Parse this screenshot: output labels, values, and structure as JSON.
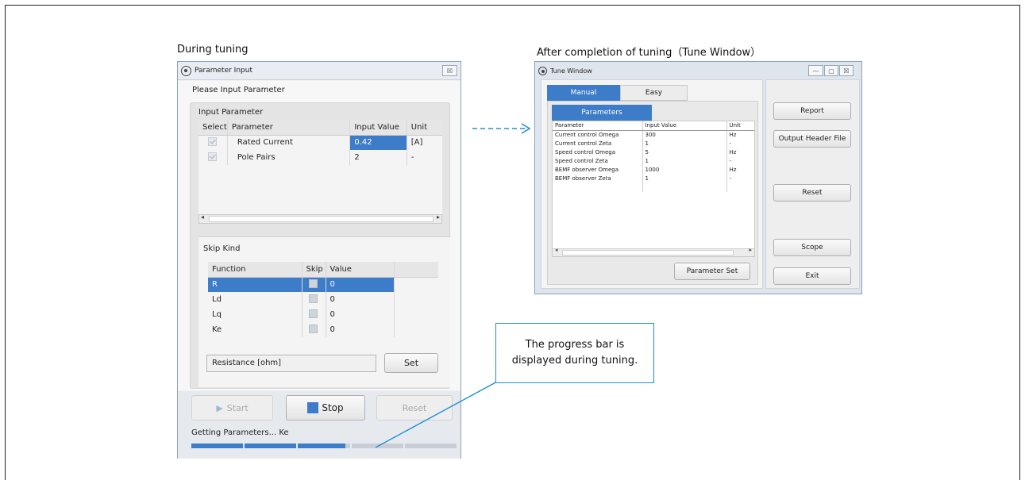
{
  "captions": {
    "during": "During tuning",
    "after": "After completion of tuning（Tune Window）"
  },
  "param_window": {
    "title": "Parameter Input",
    "close_glyph": "☒",
    "prompt": "Please Input Parameter",
    "input_group_label": "Input Parameter",
    "input_table": {
      "headers": [
        "Select",
        "Parameter",
        "Input Value",
        "Unit"
      ],
      "rows": [
        {
          "parameter": "Rated Current",
          "value": "0.42",
          "unit": "[A]"
        },
        {
          "parameter": "Pole Pairs",
          "value": "2",
          "unit": "-"
        }
      ]
    },
    "scroll_left": "◂",
    "scroll_right": "▸",
    "skip_group_label": "Skip Kind",
    "skip_table": {
      "headers": [
        "Function",
        "Skip",
        "Value"
      ],
      "rows": [
        {
          "function": "R",
          "value": "0"
        },
        {
          "function": "Ld",
          "value": "0"
        },
        {
          "function": "Lq",
          "value": "0"
        },
        {
          "function": "Ke",
          "value": "0"
        }
      ]
    },
    "resistance_field": "Resistance [ohm]",
    "set_label": "Set",
    "start_label": "Start",
    "stop_label": "Stop",
    "reset_label": "Reset",
    "status": "Getting Parameters... Ke",
    "progress": 0.58,
    "colors": {
      "accent": "#3d7cc9",
      "progress_done": "#3d7cc9",
      "progress_todo": "#c9ced6"
    }
  },
  "tune_window": {
    "title": "Tune Window",
    "tabs": [
      "Manual",
      "Easy"
    ],
    "sub_tab": "Parameters",
    "table": {
      "headers": [
        "Parameter",
        "Input Value",
        "Unit"
      ],
      "rows": [
        {
          "parameter": "Current control Omega",
          "value": "300",
          "unit": "Hz"
        },
        {
          "parameter": "Current control Zeta",
          "value": "1",
          "unit": "-"
        },
        {
          "parameter": "Speed control Omega",
          "value": "5",
          "unit": "Hz"
        },
        {
          "parameter": "Speed control Zeta",
          "value": "1",
          "unit": "-"
        },
        {
          "parameter": "BEMF observer Omega",
          "value": "1000",
          "unit": "Hz"
        },
        {
          "parameter": "BEMF observer Zeta",
          "value": "1",
          "unit": "-"
        }
      ]
    },
    "param_set_label": "Parameter Set",
    "buttons": [
      "Report",
      "Output Header File",
      "Reset",
      "Scope",
      "Exit"
    ],
    "window_glyphs": [
      "—",
      "▢",
      "☒"
    ]
  },
  "callout": {
    "line1": "The progress bar is",
    "line2": "displayed during tuning."
  }
}
